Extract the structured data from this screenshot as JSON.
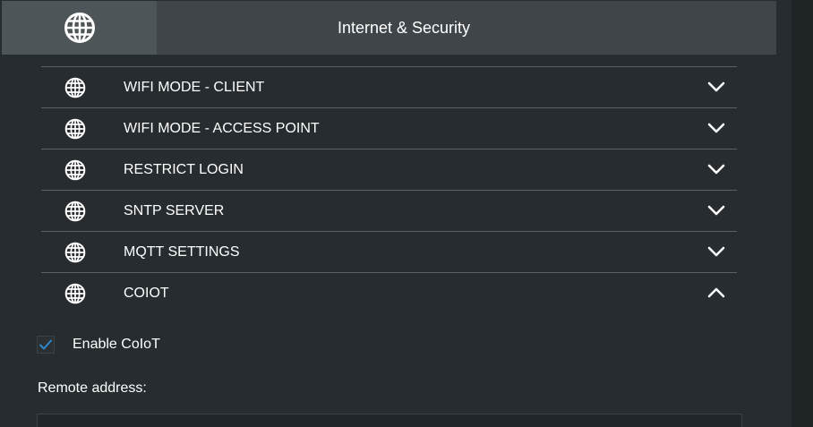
{
  "header": {
    "icon": "globe-icon",
    "title": "Internet & Security"
  },
  "sections": [
    {
      "label": "WIFI MODE - CLIENT",
      "icon": "globe-icon",
      "state": "collapsed"
    },
    {
      "label": "WIFI MODE - ACCESS POINT",
      "icon": "globe-icon",
      "state": "collapsed"
    },
    {
      "label": "RESTRICT LOGIN",
      "icon": "globe-icon",
      "state": "collapsed"
    },
    {
      "label": "SNTP SERVER",
      "icon": "globe-icon",
      "state": "collapsed"
    },
    {
      "label": "MQTT SETTINGS",
      "icon": "globe-icon",
      "state": "collapsed"
    },
    {
      "label": "COIOT",
      "icon": "globe-icon",
      "state": "expanded"
    }
  ],
  "coiot": {
    "enable_label": "Enable CoIoT",
    "enabled": true,
    "remote_address_label": "Remote address:",
    "remote_address_value": ""
  },
  "colors": {
    "background": "#262c2f",
    "header_bg": "#3f4549",
    "header_icon_bg": "#4e5558",
    "divider": "#5b6266",
    "check_accent": "#2f86c9"
  }
}
